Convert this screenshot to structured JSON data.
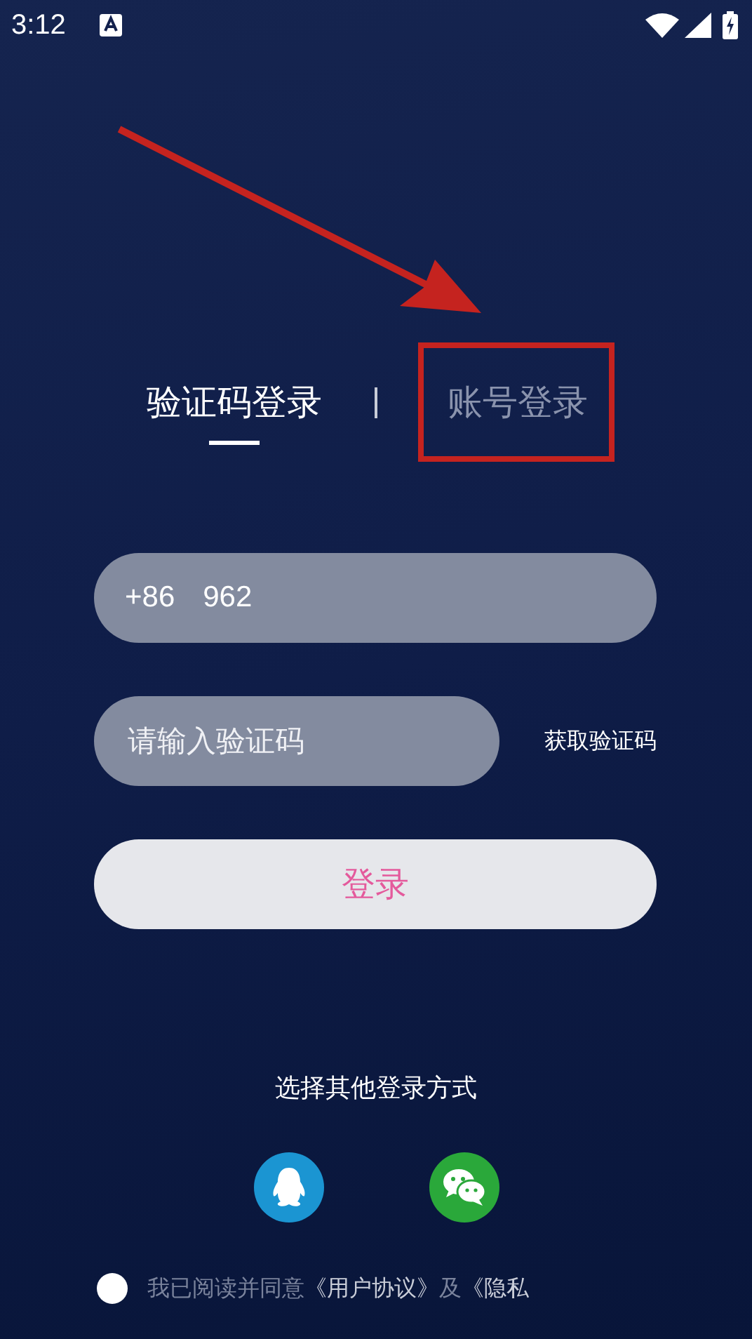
{
  "status_bar": {
    "time": "3:12"
  },
  "tabs": [
    {
      "label": "验证码登录",
      "selected": true
    },
    {
      "label": "账号登录",
      "selected": false
    }
  ],
  "phone": {
    "country_code": "+86",
    "value": "962"
  },
  "code": {
    "placeholder": "请输入验证码",
    "action": "获取验证码"
  },
  "login_button": "登录",
  "other_login": {
    "title": "选择其他登录方式",
    "options": [
      {
        "kind": "qq"
      },
      {
        "kind": "wechat"
      }
    ]
  },
  "agreement": {
    "checked": false,
    "parts": [
      {
        "kind": "text",
        "text": "我已阅读并同意"
      },
      {
        "kind": "link",
        "text": "《用户协议》"
      },
      {
        "kind": "text",
        "text": "及"
      },
      {
        "kind": "link",
        "text": "《隐私"
      }
    ]
  }
}
